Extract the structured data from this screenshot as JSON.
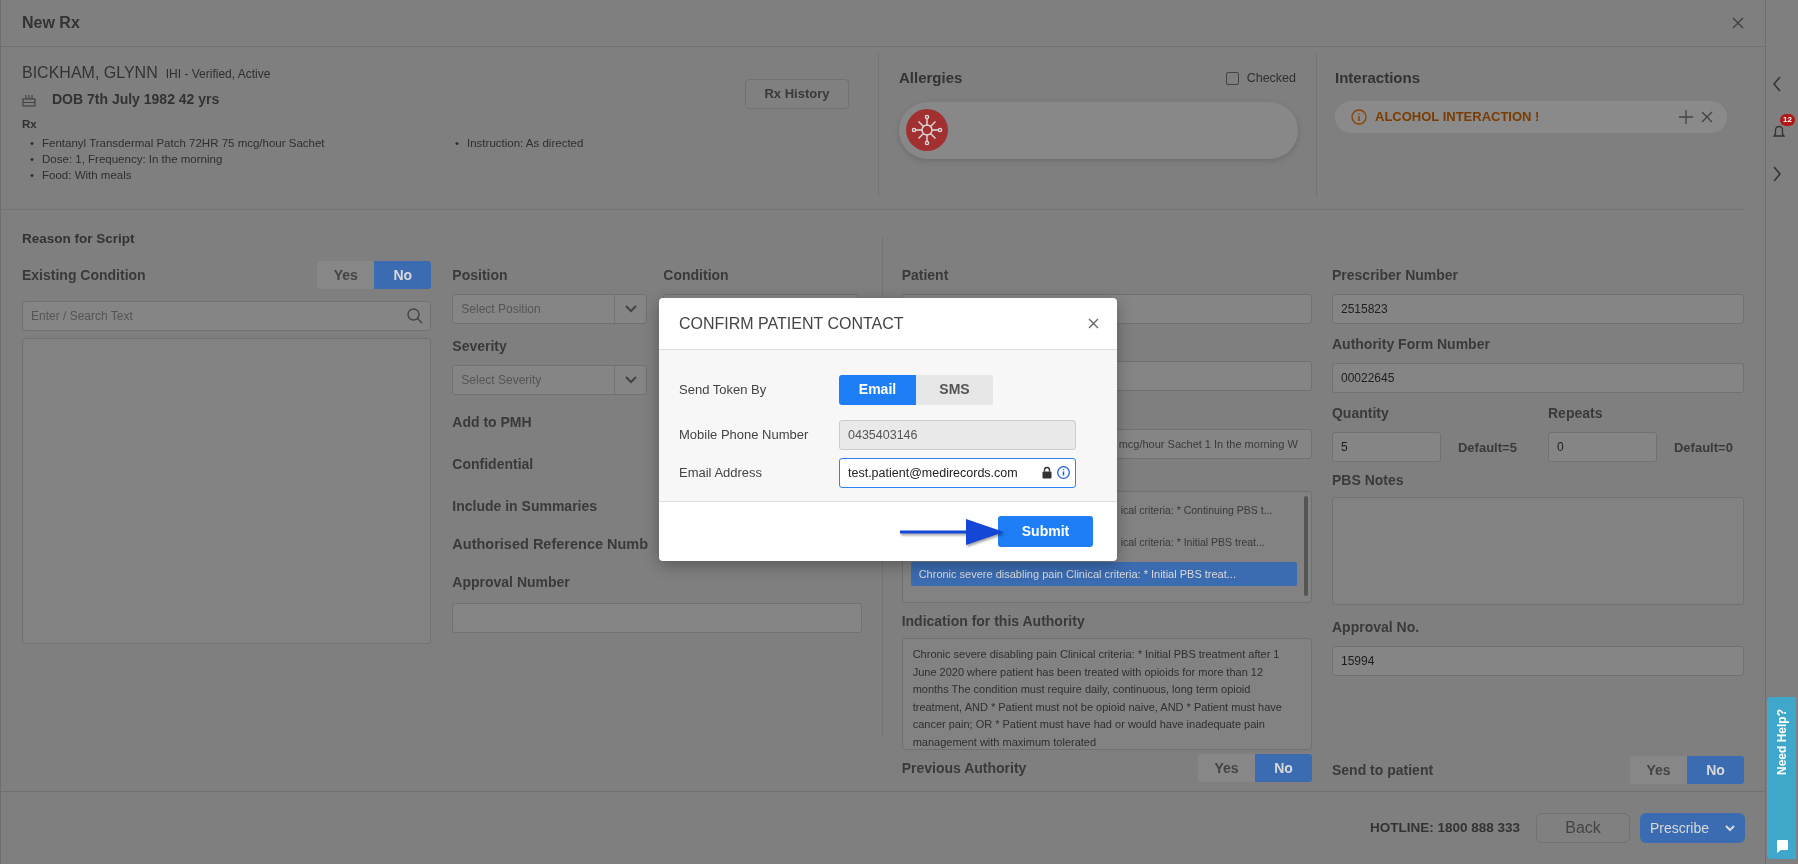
{
  "window": {
    "title": "New Rx"
  },
  "patient": {
    "bullet": "•",
    "name": "BICKHAM, GLYNN",
    "ihi_status": "IHI - Verified, Active",
    "dob": "DOB 7th July 1982 42 yrs",
    "rx_heading": "Rx",
    "rx_columns": [
      [
        "Fentanyl Transdermal Patch 72HR 75 mcg/hour Sachet",
        "Dose: 1, Frequency: In the morning",
        "Food: With meals"
      ],
      [
        "Instruction: As directed"
      ]
    ],
    "history_button": "Rx History"
  },
  "allergies": {
    "title": "Allergies",
    "checked_label": "Checked",
    "checked": false
  },
  "interactions": {
    "title": "Interactions",
    "items": [
      {
        "text": "ALCOHOL INTERACTION !"
      }
    ]
  },
  "reason": {
    "title": "Reason for Script",
    "existing_condition": {
      "label": "Existing Condition",
      "options": [
        {
          "label": "Yes",
          "selected": false
        },
        {
          "label": "No",
          "selected": true
        }
      ]
    },
    "search": {
      "placeholder": "Enter / Search Text"
    }
  },
  "details": {
    "position": {
      "label": "Position",
      "placeholder": "Select Position"
    },
    "condition": {
      "label": "Condition"
    },
    "severity": {
      "label": "Severity",
      "placeholder": "Select Severity"
    },
    "flags": [
      "Add to PMH",
      "Confidential",
      "Include in Summaries"
    ],
    "reference_heading": "Authorised Reference Numb",
    "approval_number": {
      "label": "Approval Number"
    }
  },
  "authority": {
    "patient_label": "Patient",
    "medication_text": "mcg/hour Sachet 1 In the morning W",
    "indications": [
      {
        "text": "ical criteria: * Continuing PBS t...",
        "selected": false
      },
      {
        "text": "ical criteria: * Initial PBS treat...",
        "selected": false
      },
      {
        "text": "Chronic severe disabling pain Clinical criteria: * Initial PBS treat...",
        "selected": true
      }
    ],
    "indication_label": "Indication for this Authority",
    "indication_text": "Chronic severe disabling pain Clinical criteria: * Initial PBS treatment after 1 June 2020 where patient has been treated with opioids for more than 12 months The condition must require daily, continuous, long term opioid treatment, AND * Patient must not be opioid naive, AND * Patient must have cancer pain; OR * Patient must have had or would have inadequate pain management with maximum tolerated",
    "previous_authority": {
      "label": "Previous Authority",
      "options": [
        {
          "label": "Yes",
          "selected": false
        },
        {
          "label": "No",
          "selected": true
        }
      ]
    }
  },
  "prescriber": {
    "prescriber_number": {
      "label": "Prescriber Number",
      "value": "2515823"
    },
    "authority_form_number": {
      "label": "Authority Form Number",
      "value": "00022645"
    },
    "quantity": {
      "label": "Quantity",
      "value": "5",
      "default": "Default=5"
    },
    "repeats": {
      "label": "Repeats",
      "value": "0",
      "default": "Default=0"
    },
    "pbs_notes": {
      "label": "PBS Notes"
    },
    "approval_no": {
      "label": "Approval No.",
      "value": "15994"
    },
    "send_to_patient": {
      "label": "Send to patient",
      "options": [
        {
          "label": "Yes",
          "selected": false
        },
        {
          "label": "No",
          "selected": true
        }
      ]
    }
  },
  "footer": {
    "hotline": "HOTLINE: 1800 888 333",
    "back": "Back",
    "prescribe": "Prescribe"
  },
  "side_panel": {
    "badge": "12",
    "help": "Need Help?"
  },
  "modal": {
    "title": "CONFIRM PATIENT CONTACT",
    "send_token": {
      "label": "Send Token By",
      "options": [
        {
          "label": "Email",
          "selected": true
        },
        {
          "label": "SMS",
          "selected": false
        }
      ]
    },
    "mobile": {
      "label": "Mobile Phone Number",
      "value": "0435403146",
      "disabled": true
    },
    "email": {
      "label": "Email Address",
      "value": "test.patient@medirecords.com",
      "disabled": false
    },
    "submit": "Submit"
  }
}
